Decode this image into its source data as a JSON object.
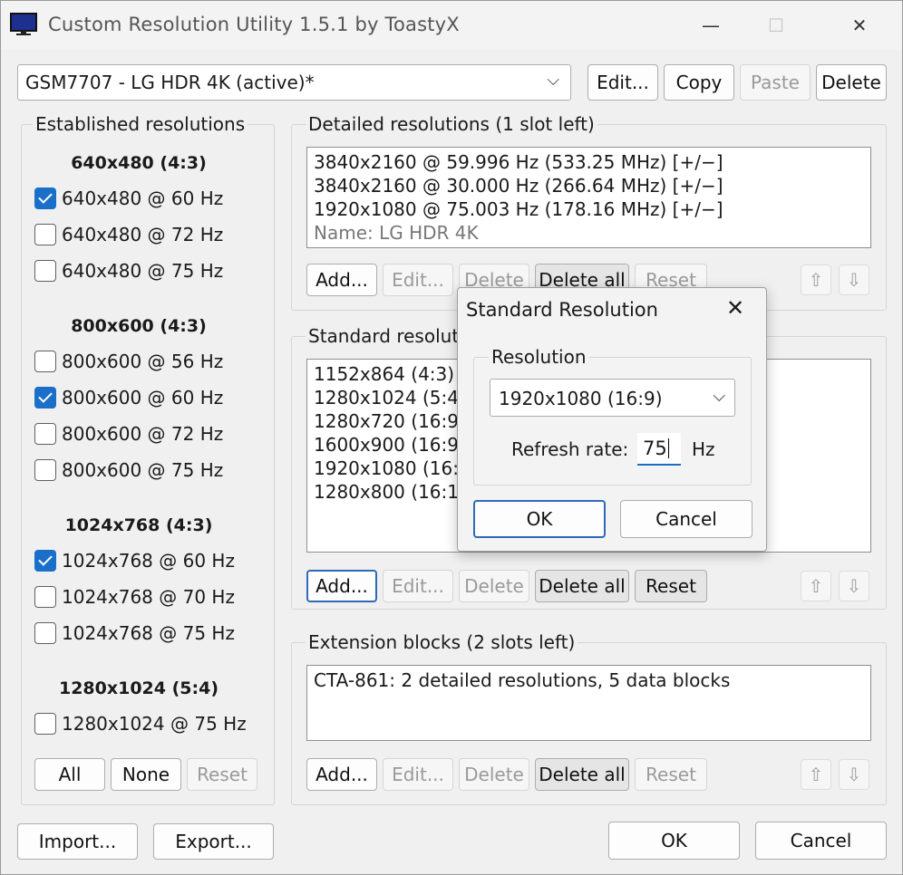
{
  "window": {
    "title": "Custom Resolution Utility 1.5.1 by ToastyX",
    "minimize": "—",
    "maximize": "☐",
    "close": "✕"
  },
  "monitor": {
    "selected": "GSM7707 - LG HDR 4K (active)*",
    "edit": "Edit...",
    "copy": "Copy",
    "paste": "Paste",
    "delete": "Delete"
  },
  "established": {
    "title": "Established resolutions",
    "groups": [
      {
        "head": "640x480 (4:3)",
        "items": [
          {
            "label": "640x480 @ 60 Hz",
            "checked": true
          },
          {
            "label": "640x480 @ 72 Hz",
            "checked": false
          },
          {
            "label": "640x480 @ 75 Hz",
            "checked": false
          }
        ]
      },
      {
        "head": "800x600 (4:3)",
        "items": [
          {
            "label": "800x600 @ 56 Hz",
            "checked": false
          },
          {
            "label": "800x600 @ 60 Hz",
            "checked": true
          },
          {
            "label": "800x600 @ 72 Hz",
            "checked": false
          },
          {
            "label": "800x600 @ 75 Hz",
            "checked": false
          }
        ]
      },
      {
        "head": "1024x768 (4:3)",
        "items": [
          {
            "label": "1024x768 @ 60 Hz",
            "checked": true
          },
          {
            "label": "1024x768 @ 70 Hz",
            "checked": false
          },
          {
            "label": "1024x768 @ 75 Hz",
            "checked": false
          }
        ]
      },
      {
        "head": "1280x1024 (5:4)",
        "items": [
          {
            "label": "1280x1024 @ 75 Hz",
            "checked": false
          }
        ]
      }
    ],
    "all": "All",
    "none": "None",
    "reset": "Reset"
  },
  "detailed": {
    "title": "Detailed resolutions (1 slot left)",
    "items": [
      "3840x2160 @ 59.996 Hz (533.25 MHz) [+/−]",
      "3840x2160 @ 30.000 Hz (266.64 MHz) [+/−]",
      "1920x1080 @ 75.003 Hz (178.16 MHz) [+/−]"
    ],
    "name": "Name: LG HDR 4K",
    "add": "Add...",
    "edit": "Edit...",
    "delete": "Delete",
    "delete_all": "Delete all",
    "reset": "Reset"
  },
  "standard": {
    "title": "Standard resolutions",
    "items": [
      "1152x864 (4:3) @",
      "1280x1024 (5:4) @",
      "1280x720 (16:9) @",
      "1600x900 (16:9) @",
      "1920x1080 (16:9) @",
      "1280x800 (16:10) @"
    ],
    "add": "Add...",
    "edit": "Edit...",
    "delete": "Delete",
    "delete_all": "Delete all",
    "reset": "Reset"
  },
  "extension": {
    "title": "Extension blocks (2 slots left)",
    "items": [
      "CTA-861: 2 detailed resolutions, 5 data blocks"
    ],
    "add": "Add...",
    "edit": "Edit...",
    "delete": "Delete",
    "delete_all": "Delete all",
    "reset": "Reset"
  },
  "arrows": {
    "up": "⇧",
    "down": "⇩"
  },
  "footer": {
    "import": "Import...",
    "export": "Export...",
    "ok": "OK",
    "cancel": "Cancel"
  },
  "dialog": {
    "title": "Standard Resolution",
    "close": "✕",
    "group": "Resolution",
    "resolution": "1920x1080 (16:9)",
    "refresh_label": "Refresh rate:",
    "refresh_value": "75",
    "unit": "Hz",
    "ok": "OK",
    "cancel": "Cancel"
  },
  "colors": {
    "accent": "#1a6fc9",
    "focus": "#2d6ab8"
  }
}
